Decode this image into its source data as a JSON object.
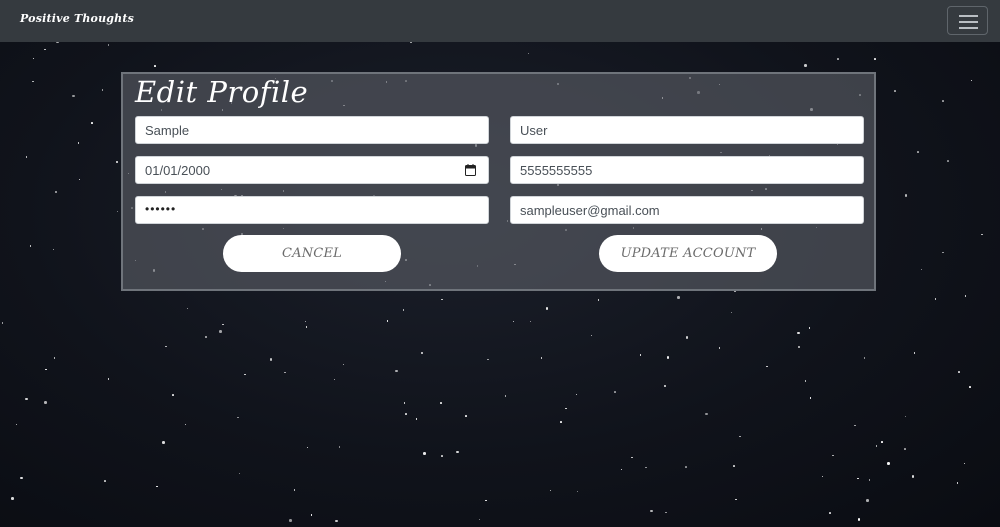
{
  "navbar": {
    "brand": "Positive Thoughts",
    "menu_icon": "hamburger-menu-icon"
  },
  "form": {
    "title": "Edit Profile",
    "first_name": "Sample",
    "last_name": "User",
    "birthdate": "01/01/2000",
    "phone": "5555555555",
    "password_mask": "••••••",
    "email": "sampleuser@gmail.com",
    "date_picker_icon": "calendar-icon",
    "cancel_label": "CANCEL",
    "update_label": "UPDATE ACCOUNT"
  },
  "colors": {
    "navbar_bg": "#353a3f",
    "panel_bg": "#5c6068",
    "page_bg": "#10131b"
  }
}
